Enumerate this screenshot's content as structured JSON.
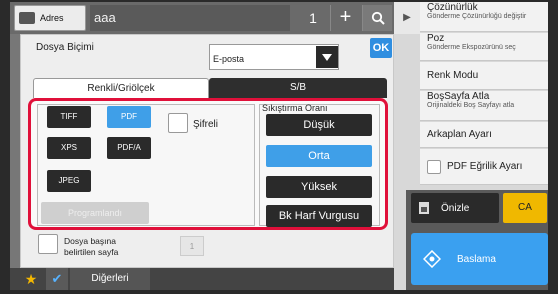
{
  "topbar": {
    "address_label": "Adres",
    "address_value": "aaa",
    "count": "1",
    "plus": "+",
    "arrow": "▶"
  },
  "dialog": {
    "format_label": "Dosya Biçimi",
    "format_value": "E-posta",
    "ok_label": "OK",
    "tabs": [
      "Renkli/Griölçek",
      "S/B"
    ],
    "file_types": [
      "TIFF",
      "PDF",
      "XPS",
      "PDF/A",
      "JPEG"
    ],
    "selected_file_type": "PDF",
    "encrypted_label": "Şifreli",
    "programmed_label": "Programlandı",
    "compression": {
      "label": "Sıkıştırma Oranı",
      "options": [
        "Düşük",
        "Orta",
        "Yüksek",
        "Bk Harf Vurgusu"
      ],
      "selected": "Orta"
    },
    "per_page_label_1": "Dosya başına",
    "per_page_label_2": "belirtilen sayfa",
    "per_page_value": "1"
  },
  "bottombar": {
    "others_label": "Diğerleri"
  },
  "menu": {
    "items": [
      {
        "title": "Çözünürlük",
        "sub": "Gönderme Çözünürlüğü değiştir"
      },
      {
        "title": "Poz",
        "sub": "Gönderme Ekspozürünü seç"
      },
      {
        "title": "Renk Modu",
        "sub": ""
      },
      {
        "title": "BoşSayfa Atla",
        "sub": "Orijinaldeki Boş Sayfayı atla"
      },
      {
        "title": "Arkaplan Ayarı",
        "sub": ""
      },
      {
        "title": "PDF Eğrilik Ayarı",
        "sub": ""
      }
    ],
    "preview_label": "Önizle",
    "ca_label": "CA",
    "start_label": "Baslama"
  },
  "colors": {
    "accent_blue": "#3f9fe8",
    "highlight_red": "#e0103a",
    "ca_yellow": "#f0b800"
  }
}
